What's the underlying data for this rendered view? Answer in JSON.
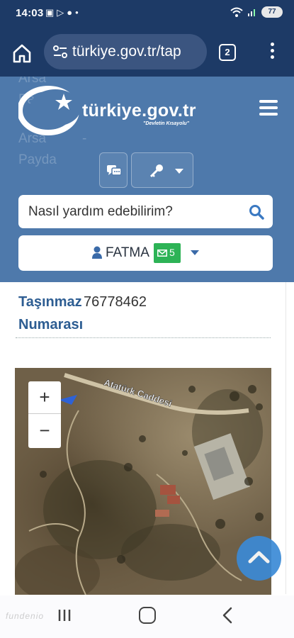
{
  "status_bar": {
    "time": "14:03",
    "battery": "77",
    "left_icons": [
      "screenshot-icon",
      "youtube-icon",
      "message-icon",
      "dot-icon"
    ],
    "right_icons": [
      "wifi-icon",
      "signal-icon",
      "battery-icon"
    ]
  },
  "browser": {
    "url": "türkiye.gov.tr/tap",
    "tab_count": "2",
    "icons": [
      "home-icon",
      "site-settings-icon",
      "tabs-icon",
      "more-menu-icon"
    ]
  },
  "site": {
    "logo_text": "türkiye.gov.tr",
    "logo_subtext": "\"Devletin Kısayolu\"",
    "background_labels": [
      "Arsa",
      "Pa",
      "Arsa",
      "Payda"
    ],
    "background_dash": "-",
    "search_placeholder": "Nasıl yardım edebilirim?",
    "user_name": "FATMA",
    "message_count": "5",
    "colors": {
      "header": "#4e79ab",
      "topbar": "#1d3a66",
      "label": "#2d5d92",
      "badge": "#2db356",
      "scroll_button": "#3b8ad6"
    }
  },
  "content": {
    "field_label_line1": "Taşınmaz",
    "field_label_line2": "Numarası",
    "field_value": "76778462"
  },
  "map": {
    "road_label": "Atatürk Caddesi",
    "zoom_in": "+",
    "zoom_out": "−"
  },
  "nav": {
    "watermark": "fundenio",
    "icons": [
      "recent-apps-icon",
      "home-circle-icon",
      "back-icon"
    ]
  }
}
